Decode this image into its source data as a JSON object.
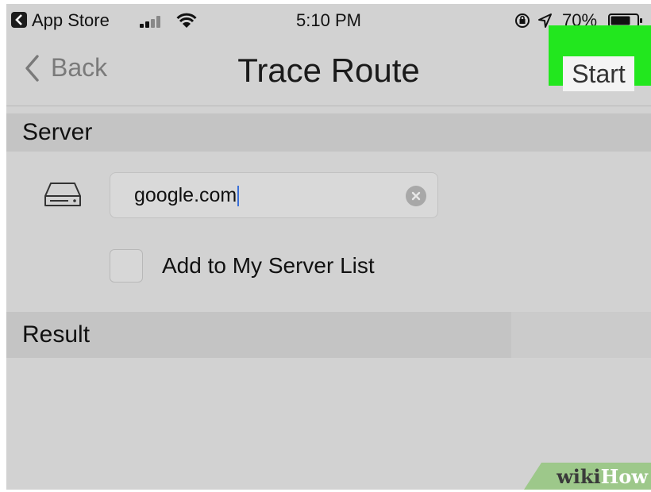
{
  "status_bar": {
    "app_name": "App Store",
    "time": "5:10 PM",
    "battery_percent": "70%",
    "icons": [
      "back-app-icon",
      "signal-icon",
      "wifi-icon",
      "rotation-lock-icon",
      "location-arrow-icon",
      "battery-icon"
    ]
  },
  "nav": {
    "back_label": "Back",
    "title": "Trace Route",
    "start_label": "Start",
    "highlight_color": "#22e71e"
  },
  "server": {
    "section_label": "Server",
    "host_value": "google.com",
    "add_to_list_label": "Add to My Server List",
    "add_to_list_checked": false
  },
  "result": {
    "section_label": "Result"
  },
  "watermark": {
    "wiki": "wiki",
    "how": "How"
  }
}
